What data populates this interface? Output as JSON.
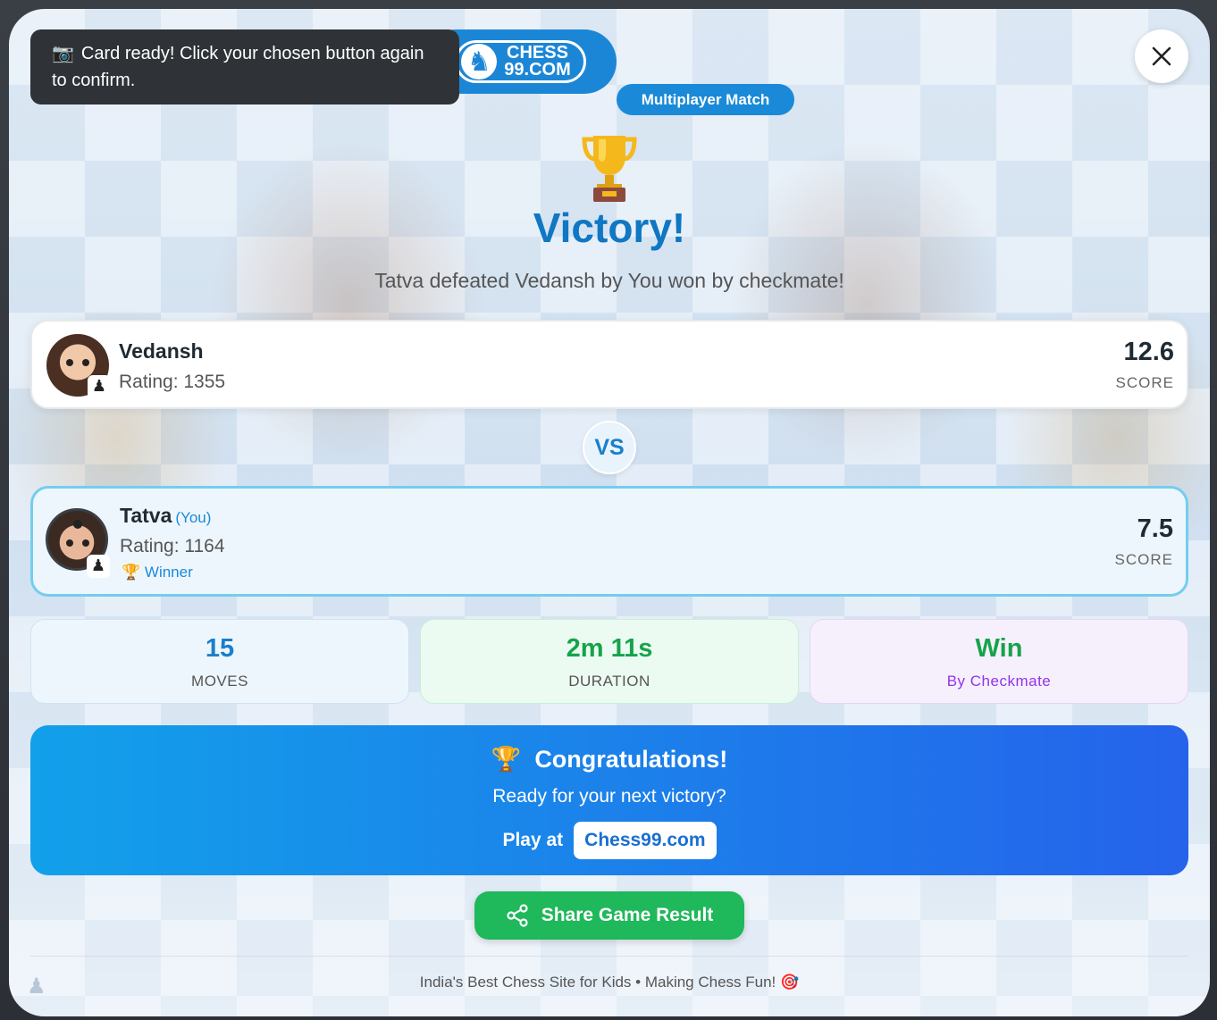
{
  "toast": {
    "icon": "camera-icon",
    "text": "Card ready! Click your chosen button again to confirm."
  },
  "brand": {
    "logo_text_line1": "CHESS",
    "logo_text_line2": "99.COM",
    "icon": "chess-knight-icon",
    "color": "#1c86d6"
  },
  "badge": {
    "label": "Multiplayer Match"
  },
  "close": {
    "icon": "close-icon"
  },
  "header": {
    "trophy_icon": "trophy-icon",
    "title": "Victory!",
    "subtitle": "Tatva defeated Vedansh by You won by checkmate!"
  },
  "opponent": {
    "name": "Vedansh",
    "rating": "Rating: 1355",
    "score": "12.6",
    "score_label": "SCORE",
    "piece_icon": "chess-pawn-icon"
  },
  "vs_label": "VS",
  "player": {
    "name": "Tatva",
    "you_tag": "(You)",
    "rating": "Rating: 1164",
    "winner_label": "Winner",
    "winner_icon": "trophy-icon",
    "score": "7.5",
    "score_label": "SCORE",
    "piece_icon": "chess-pawn-icon"
  },
  "stats": {
    "moves": {
      "value": "15",
      "label": "MOVES"
    },
    "duration": {
      "value": "2m 11s",
      "label": "DURATION"
    },
    "result": {
      "value": "Win",
      "label": "By Checkmate"
    }
  },
  "congrats": {
    "icon": "trophy-icon",
    "title": "Congratulations!",
    "subtitle": "Ready for your next victory?",
    "play_label": "Play at",
    "site_button": "Chess99.com"
  },
  "share": {
    "label": "Share Game Result",
    "icon": "share-icon"
  },
  "footer": {
    "text": "India's Best Chess Site for Kids • Making Chess Fun!",
    "icon": "target-icon"
  },
  "colors": {
    "accent": "#1a8ad8",
    "success": "#16a34a",
    "purple": "#9333ea",
    "gradient_start": "#12a0ea",
    "gradient_end": "#2563eb"
  }
}
